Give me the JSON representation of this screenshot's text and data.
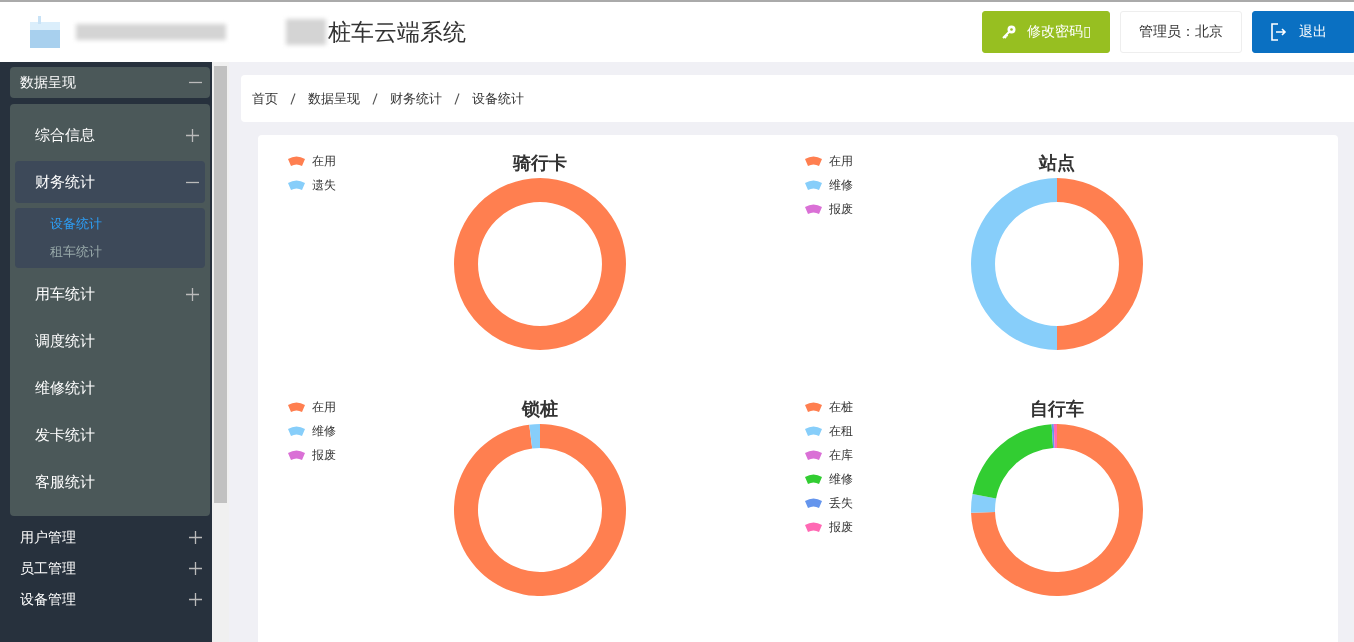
{
  "header": {
    "title": "桩车云端系统",
    "buttons": [
      {
        "kind": "password",
        "label": "修改密码▯"
      },
      {
        "kind": "user",
        "label": "管理员：北京"
      },
      {
        "kind": "logout",
        "label": "退出"
      }
    ]
  },
  "sidebar": {
    "items": [
      {
        "label": "数据呈现",
        "expanded": true,
        "children": [
          {
            "label": "综合信息",
            "expanded": false
          },
          {
            "label": "财务统计",
            "expanded": true,
            "children": [
              {
                "label": "设备统计",
                "selected": true
              },
              {
                "label": "租车统计",
                "selected": false
              }
            ]
          },
          {
            "label": "用车统计",
            "expanded": false
          },
          {
            "label": "调度统计"
          },
          {
            "label": "维修统计"
          },
          {
            "label": "发卡统计"
          },
          {
            "label": "客服统计"
          }
        ]
      },
      {
        "label": "用户管理",
        "expanded": false
      },
      {
        "label": "员工管理",
        "expanded": false
      },
      {
        "label": "设备管理",
        "expanded": false
      }
    ]
  },
  "breadcrumb": [
    "首页",
    "数据呈现",
    "财务统计",
    "设备统计"
  ],
  "charts": [
    {
      "title": "骑行卡",
      "legend": [
        {
          "label": "在用",
          "color": "#ff7f50"
        },
        {
          "label": "遗失",
          "color": "#87cefa"
        }
      ]
    },
    {
      "title": "站点",
      "legend": [
        {
          "label": "在用",
          "color": "#ff7f50"
        },
        {
          "label": "维修",
          "color": "#87cefa"
        },
        {
          "label": "报废",
          "color": "#da70d6"
        }
      ]
    },
    {
      "title": "锁桩",
      "legend": [
        {
          "label": "在用",
          "color": "#ff7f50"
        },
        {
          "label": "维修",
          "color": "#87cefa"
        },
        {
          "label": "报废",
          "color": "#da70d6"
        }
      ]
    },
    {
      "title": "自行车",
      "legend": [
        {
          "label": "在桩",
          "color": "#ff7f50"
        },
        {
          "label": "在租",
          "color": "#87cefa"
        },
        {
          "label": "在库",
          "color": "#da70d6"
        },
        {
          "label": "维修",
          "color": "#32cd32"
        },
        {
          "label": "丢失",
          "color": "#6495ed"
        },
        {
          "label": "报废",
          "color": "#ff69b4"
        }
      ]
    }
  ]
}
